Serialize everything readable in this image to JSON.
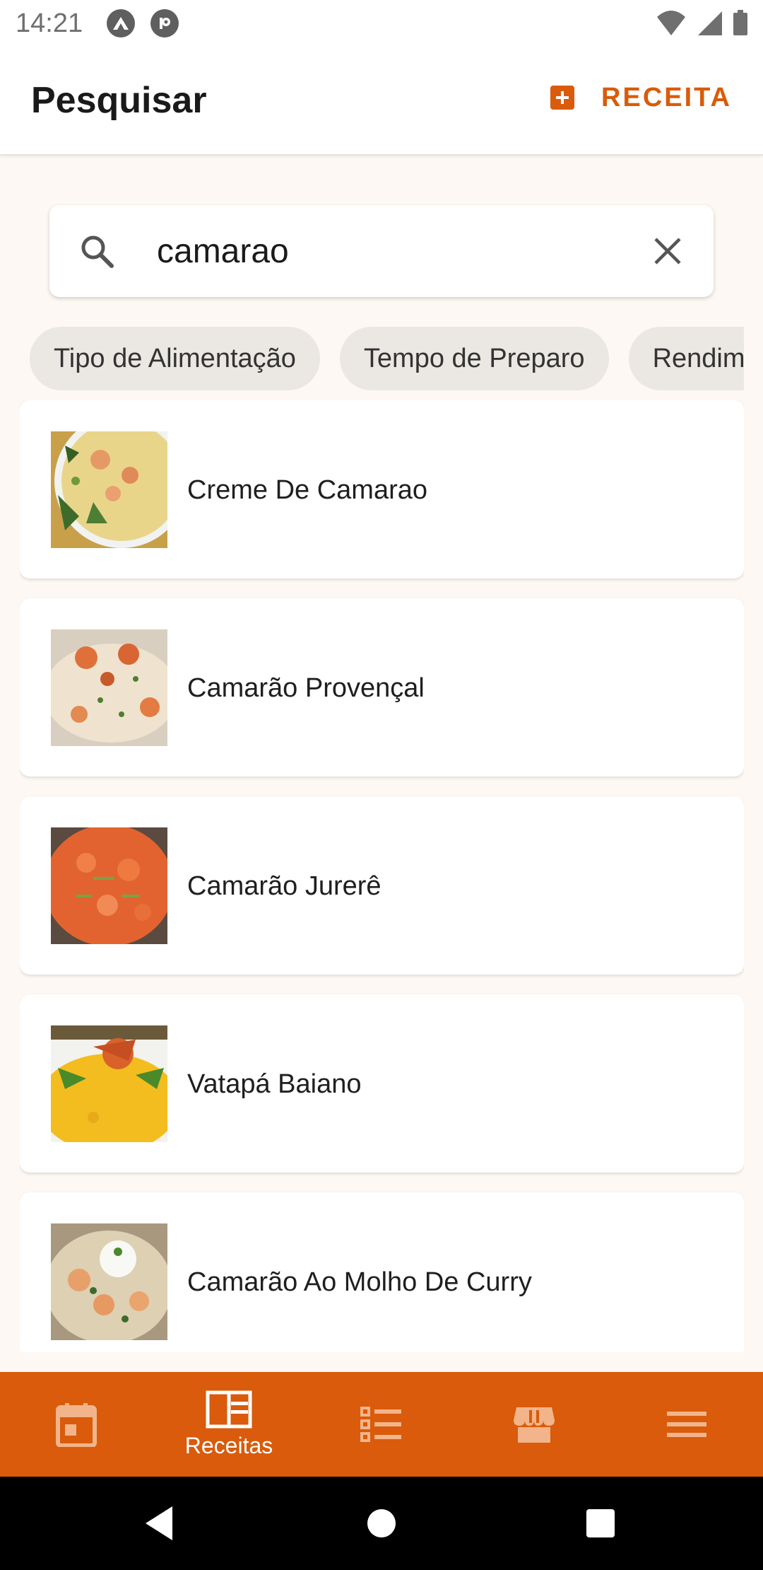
{
  "status_bar": {
    "time": "14:21",
    "app_icons": [
      "a-logo-icon",
      "p-logo-icon"
    ],
    "right_icons": [
      "wifi-icon",
      "signal-icon",
      "battery-icon"
    ]
  },
  "header": {
    "title": "Pesquisar",
    "add_button_label": "RECEITA",
    "add_button_icon": "add-box-icon"
  },
  "search": {
    "value": "camarao",
    "icon": "search-icon",
    "clear_icon": "close-icon"
  },
  "filters": {
    "chips": [
      "Tipo de Alimentação",
      "Tempo de Preparo",
      "Rendimento"
    ]
  },
  "results": [
    {
      "title": "Creme De Camarao"
    },
    {
      "title": "Camarão Provençal"
    },
    {
      "title": "Camarão Jurerê"
    },
    {
      "title": "Vatapá Baiano"
    },
    {
      "title": "Camarão Ao Molho De Curry"
    }
  ],
  "bottom_nav": {
    "items": [
      {
        "icon": "calendar-icon",
        "label": ""
      },
      {
        "icon": "book-icon",
        "label": "Receitas"
      },
      {
        "icon": "checklist-icon",
        "label": ""
      },
      {
        "icon": "store-icon",
        "label": ""
      },
      {
        "icon": "menu-icon",
        "label": ""
      }
    ],
    "active_index": 1
  },
  "system_nav": [
    "back-icon",
    "home-icon",
    "recents-icon"
  ],
  "colors": {
    "accent": "#d95b0b",
    "background": "#fdf8f3",
    "chip": "#ebe7e3",
    "card": "#ffffff"
  }
}
